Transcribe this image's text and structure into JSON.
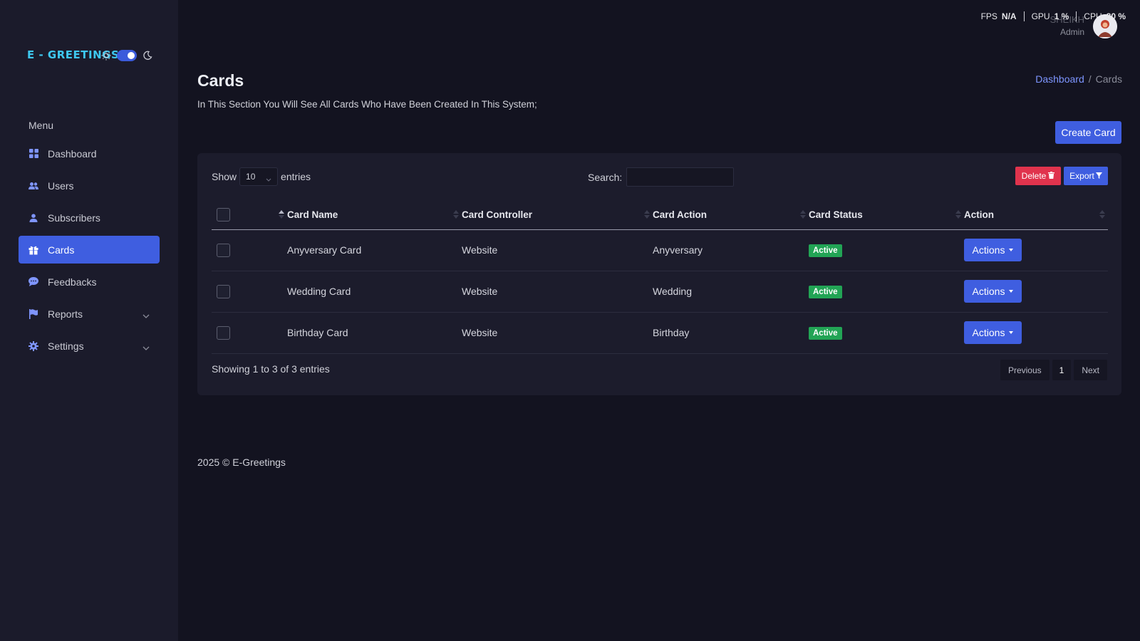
{
  "app": {
    "logo": "E - GREETINGS"
  },
  "topbar": {
    "fps_label": "FPS",
    "fps_value": "N/A",
    "gpu_label": "GPU",
    "gpu_value": "1 %",
    "cpu_label": "CPU",
    "cpu_value": "80 %",
    "user_name": "SHEIKH",
    "user_role": "Admin"
  },
  "sidebar": {
    "menu_title": "Menu",
    "items": [
      {
        "label": "Dashboard",
        "icon": "grid-icon"
      },
      {
        "label": "Users",
        "icon": "users-icon"
      },
      {
        "label": "Subscribers",
        "icon": "user-icon"
      },
      {
        "label": "Cards",
        "icon": "gift-icon",
        "active": true
      },
      {
        "label": "Feedbacks",
        "icon": "chat-icon"
      },
      {
        "label": "Reports",
        "icon": "flag-icon",
        "expandable": true
      },
      {
        "label": "Settings",
        "icon": "gear-icon",
        "expandable": true
      }
    ]
  },
  "page": {
    "title": "Cards",
    "description": "In This Section You Will See All Cards Who Have Been Created In This System;",
    "breadcrumb": {
      "home": "Dashboard",
      "separator": "/",
      "current": "Cards"
    },
    "create_button": "Create Card"
  },
  "table_controls": {
    "show_label": "Show",
    "entries_value": "10",
    "entries_label": "entries",
    "search_label": "Search:",
    "search_value": "",
    "delete_label": "Delete",
    "export_label": "Export"
  },
  "table": {
    "columns": [
      "Card Name",
      "Card Controller",
      "Card Action",
      "Card Status",
      "Action"
    ],
    "rows": [
      {
        "name": "Anyversary Card",
        "controller": "Website",
        "action": "Anyversary",
        "status": "Active",
        "button": "Actions"
      },
      {
        "name": "Wedding Card",
        "controller": "Website",
        "action": "Wedding",
        "status": "Active",
        "button": "Actions"
      },
      {
        "name": "Birthday Card",
        "controller": "Website",
        "action": "Birthday",
        "status": "Active",
        "button": "Actions"
      }
    ]
  },
  "pagination": {
    "info": "Showing 1 to 3 of 3 entries",
    "previous": "Previous",
    "current": "1",
    "next": "Next"
  },
  "footer": {
    "text": "2025 © E-Greetings"
  },
  "colors": {
    "accent": "#3f5ee0",
    "danger": "#e0334d",
    "success": "#22a455",
    "background": "#131320",
    "sidebar": "#1b1b2b"
  }
}
